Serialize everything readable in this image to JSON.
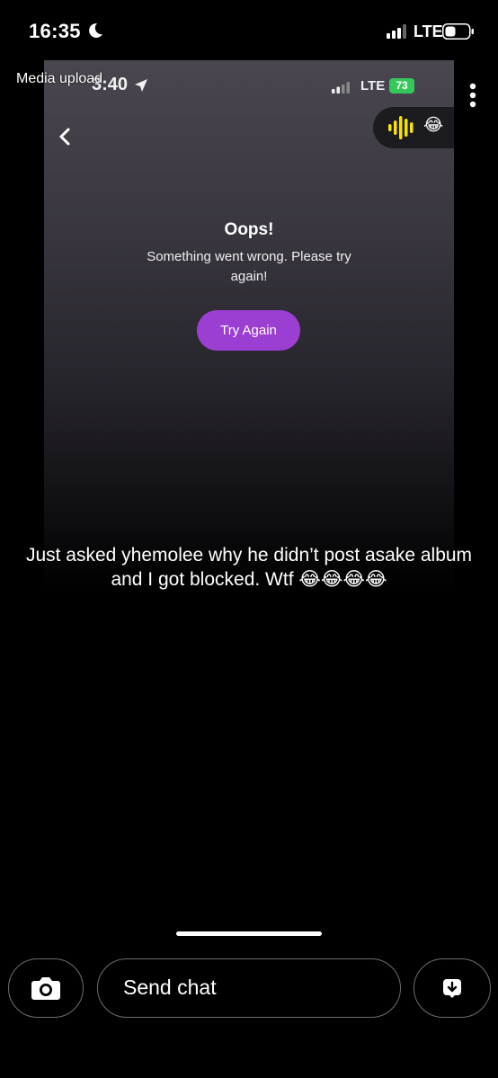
{
  "status_bar": {
    "time": "16:35",
    "network": "LTE"
  },
  "media": {
    "label": "Media upload",
    "inner_status": {
      "time": "3:40",
      "network": "LTE",
      "battery": "73"
    },
    "error_title": "Oops!",
    "error_message": "Something went wrong. Please try again!",
    "retry_label": "Try Again",
    "emoji": "😂"
  },
  "caption": "Just asked yhemolee why he didn’t post asake album and I got blocked. Wtf 😂😂😂😂",
  "chat_bar": {
    "send_placeholder": "Send chat"
  },
  "colors": {
    "accent_purple": "#9b3fd2",
    "voice_yellow": "#f5e400",
    "battery_green": "#34c759"
  },
  "icons": [
    "moon-icon",
    "signal-icon",
    "battery-icon",
    "location-arrow-icon",
    "back-chevron-icon",
    "sound-wave-icon",
    "more-vertical-icon",
    "camera-icon",
    "save-download-icon"
  ]
}
